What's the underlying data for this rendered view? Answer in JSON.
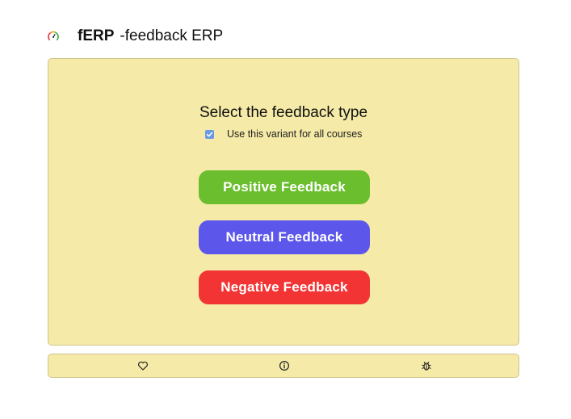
{
  "header": {
    "brand": "fERP",
    "subtitle": "-feedback ERP",
    "logo_icon": "gauge-icon"
  },
  "main": {
    "title": "Select the feedback type",
    "checkbox": {
      "label": "Use this variant for all courses",
      "checked": true
    },
    "buttons": {
      "positive": "Positive Feedback",
      "neutral": "Neutral Feedback",
      "negative": "Negative Feedback"
    }
  },
  "footer": {
    "icons": [
      "heart-icon",
      "info-icon",
      "bug-icon"
    ]
  },
  "colors": {
    "panel_background": "#f5eaa7",
    "positive": "#6bbf2e",
    "neutral": "#5c57ea",
    "negative": "#f23434",
    "checkbox": "#6b9ae3"
  }
}
